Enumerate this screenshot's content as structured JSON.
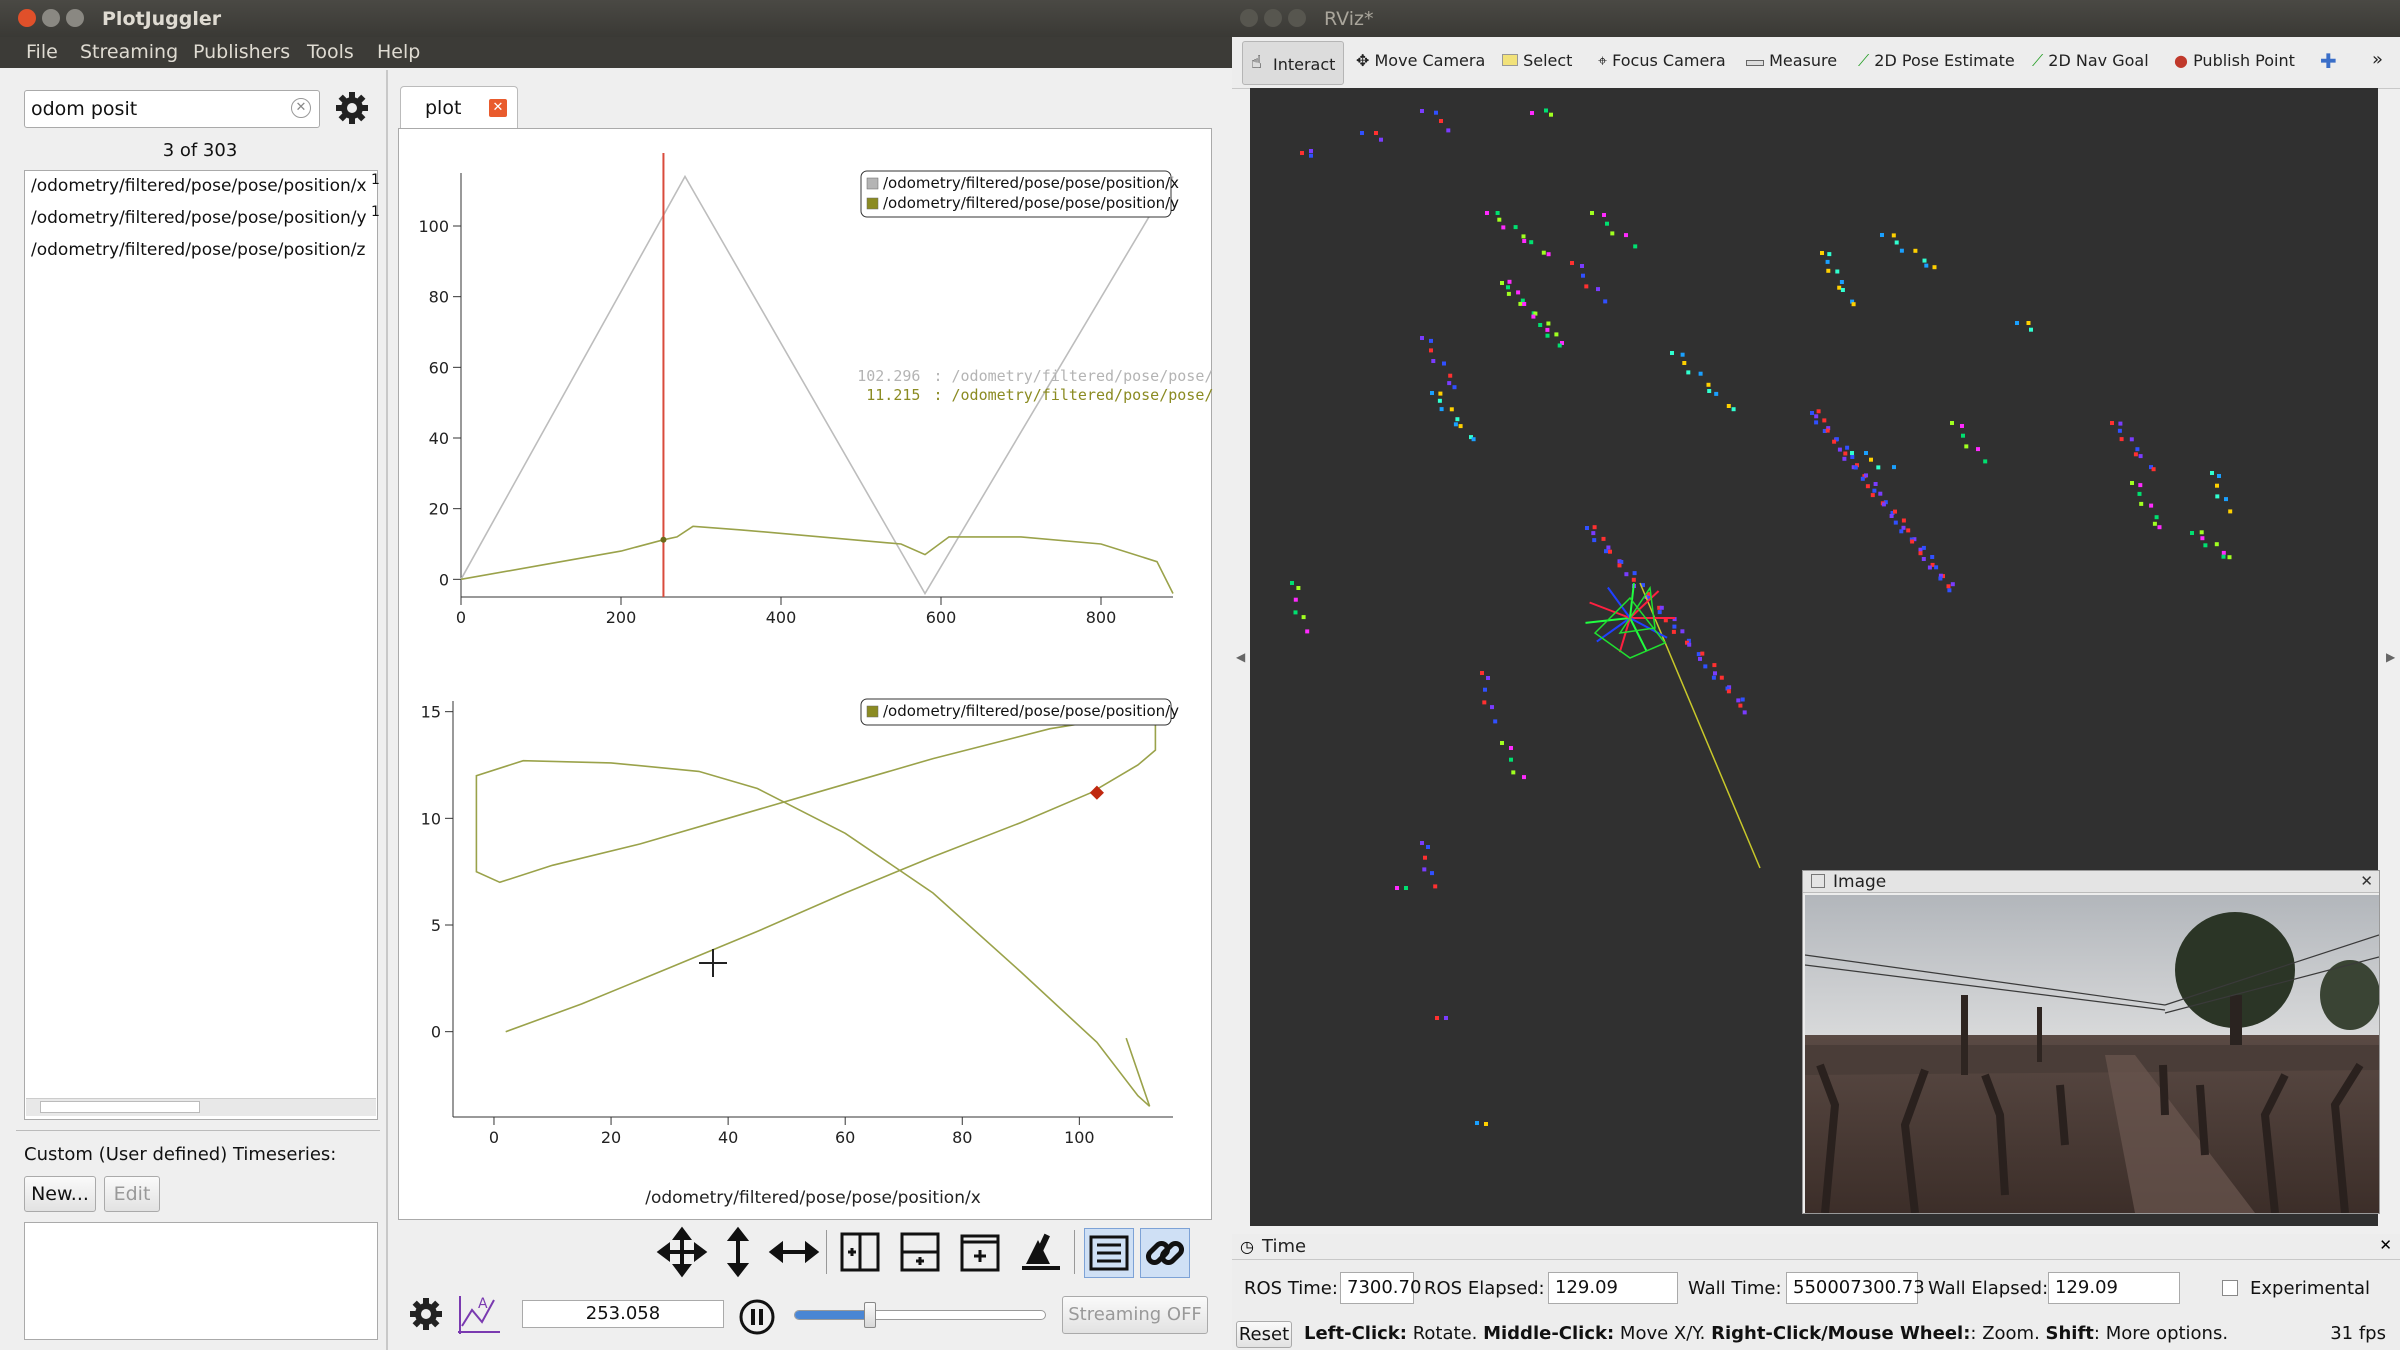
{
  "plotjuggler": {
    "title": "PlotJuggler",
    "menu": [
      "File",
      "Streaming",
      "Publishers",
      "Tools",
      "Help"
    ],
    "search_value": "odom posit",
    "count_text": "3 of 303",
    "list_items": [
      {
        "label": "/odometry/filtered/pose/pose/position/x",
        "suffix": "1"
      },
      {
        "label": "/odometry/filtered/pose/pose/position/y",
        "suffix": "1"
      },
      {
        "label": "/odometry/filtered/pose/pose/position/z",
        "suffix": ""
      }
    ],
    "custom_title": "Custom (User defined) Timeseries:",
    "new_button": "New...",
    "edit_button": "Edit",
    "tab_label": "plot",
    "time_value": "253.058",
    "streaming_button": "Streaming OFF",
    "time_slider_fraction": 0.3
  },
  "plot1": {
    "legend": [
      {
        "label": "/odometry/filtered/pose/pose/position/x",
        "color": "#b4b4b4"
      },
      {
        "label": "/odometry/filtered/pose/pose/position/y",
        "color": "#8b8b22"
      }
    ],
    "tracker": [
      {
        "value": "102.296",
        "series": "/odometry/filtered/pose/pose/position/x",
        "color": "#b4b4b4"
      },
      {
        "value": "11.215",
        "series": "/odometry/filtered/pose/pose/position/y",
        "color": "#8b8b22"
      }
    ],
    "cursor_x": 253.058
  },
  "plot2": {
    "legend": [
      {
        "label": "/odometry/filtered/pose/pose/position/y",
        "color": "#8b8b22"
      }
    ],
    "xlabel": "/odometry/filtered/pose/pose/position/x"
  },
  "chart_data": [
    {
      "type": "line",
      "x_ticks": [
        "0",
        "200",
        "400",
        "600",
        "800"
      ],
      "y_ticks": [
        "0",
        "20",
        "40",
        "60",
        "80",
        "100"
      ],
      "xlim": [
        0,
        890
      ],
      "ylim": [
        -5,
        115
      ],
      "series": [
        {
          "name": "/odometry/filtered/pose/pose/position/x",
          "color": "#bdbdbd",
          "x": [
            0,
            280,
            580,
            890
          ],
          "y": [
            0,
            114,
            -4,
            114
          ]
        },
        {
          "name": "/odometry/filtered/pose/pose/position/y",
          "color": "#9aa24a",
          "x": [
            0,
            100,
            200,
            253,
            270,
            290,
            350,
            450,
            550,
            580,
            610,
            700,
            800,
            870,
            890
          ],
          "y": [
            0,
            4,
            8,
            11.2,
            12,
            15,
            14,
            12,
            10,
            7,
            12,
            12,
            10,
            5,
            -4
          ]
        }
      ],
      "cursor": {
        "x": 253.058,
        "y": 11.215
      }
    },
    {
      "type": "line",
      "x_ticks": [
        "0",
        "20",
        "40",
        "60",
        "80",
        "100"
      ],
      "y_ticks": [
        "0",
        "5",
        "10",
        "15"
      ],
      "xlabel": "/odometry/filtered/pose/pose/position/x",
      "xlim": [
        -7,
        116
      ],
      "ylim": [
        -4,
        15.5
      ],
      "series": [
        {
          "name": "/odometry/filtered/pose/pose/position/y",
          "color": "#9aa24a",
          "x": [
            2,
            15,
            30,
            45,
            60,
            75,
            90,
            102,
            110,
            113,
            113,
            95,
            75,
            55,
            40,
            25,
            10,
            1,
            -3,
            -3,
            5,
            20,
            35,
            45,
            60,
            75,
            90,
            103,
            110,
            112,
            108
          ],
          "y": [
            0,
            1.3,
            3,
            4.7,
            6.5,
            8.2,
            9.8,
            11.2,
            12.5,
            13.2,
            15,
            14.2,
            12.8,
            11.2,
            10,
            8.8,
            7.8,
            7,
            7.5,
            12,
            12.7,
            12.6,
            12.2,
            11.4,
            9.3,
            6.5,
            2.8,
            -0.5,
            -3,
            -3.5,
            -0.3
          ]
        }
      ],
      "marker": {
        "x": 103,
        "y": 11.2
      }
    }
  ],
  "rviz": {
    "title": "RViz*",
    "tools": [
      "Interact",
      "Move Camera",
      "Select",
      "Focus Camera",
      "Measure",
      "2D Pose Estimate",
      "2D Nav Goal",
      "Publish Point"
    ],
    "image_panel_title": "Image",
    "time_panel_title": "Time",
    "ros_time_label": "ROS Time:",
    "ros_time_value": "7300.70",
    "ros_elapsed_label": "ROS Elapsed:",
    "ros_elapsed_value": "129.09",
    "wall_time_label": "Wall Time:",
    "wall_time_value": "550007300.73",
    "wall_elapsed_label": "Wall Elapsed:",
    "wall_elapsed_value": "129.09",
    "experimental_label": "Experimental",
    "reset_button": "Reset",
    "status_bold1": "Left-Click:",
    "status_text1": " Rotate. ",
    "status_bold2": "Middle-Click:",
    "status_text2": " Move X/Y. ",
    "status_bold3": "Right-Click/Mouse Wheel:",
    "status_text3": ": Zoom. ",
    "status_bold4": "Shift",
    "status_text4": ": More options.",
    "fps": "31 fps"
  }
}
